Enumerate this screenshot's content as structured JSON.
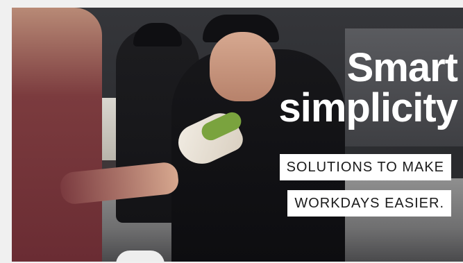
{
  "banner": {
    "headline_line1": "Smart",
    "headline_line2": "simplicity",
    "tagline_line1": "SOLUTIONS TO MAKE",
    "tagline_line2": "WORKDAYS EASIER."
  }
}
